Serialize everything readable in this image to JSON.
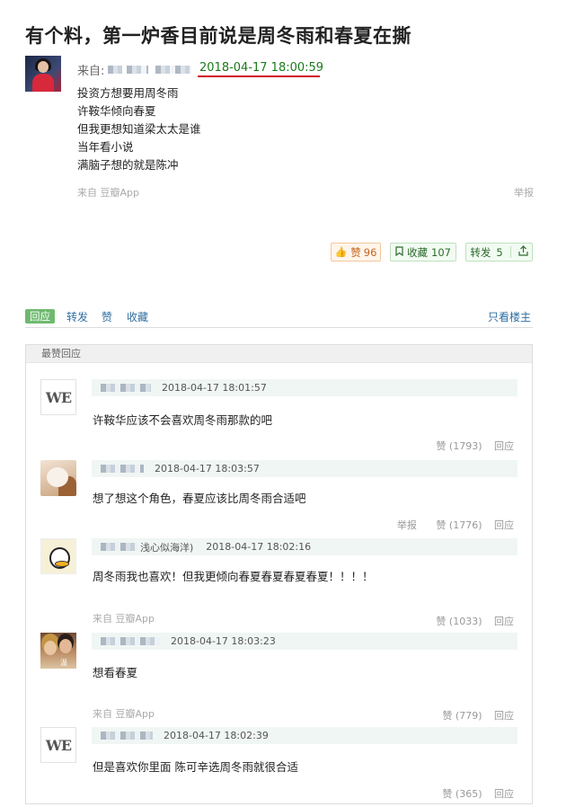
{
  "post": {
    "title": "有个料，第一炉香目前说是周冬雨和春夏在撕",
    "from_label": "来自: ",
    "published": "2018-04-17 18:00:59",
    "body": [
      "投资方想要用周冬雨",
      "许鞍华倾向春夏",
      "但我更想知道梁太太是谁",
      "当年看小说",
      "满脑子想的就是陈冲"
    ],
    "source": "来自 豆瓣App",
    "report": "举报",
    "like_label": "赞",
    "like_count": "96",
    "collect_label": "收藏",
    "collect_count": "107",
    "share_label": "转发",
    "share_count": "5",
    "accent_green": "#6fb96f",
    "accent_red": "#d0021b"
  },
  "tabs": {
    "reply": "回应",
    "forward": "转发",
    "praise": "赞",
    "collect": "收藏",
    "host_only": "只看楼主"
  },
  "replies_section": {
    "header": "最赞回应",
    "items": [
      {
        "avatar": "we-logo",
        "avatar_text": "WE",
        "name_visible": "",
        "time": "2018-04-17 18:01:57",
        "content": "许鞍华应该不会喜欢周冬雨那款的吧",
        "source": "",
        "report": "",
        "likes": "赞 (1793)",
        "reply": "回应"
      },
      {
        "avatar": "cat-dog-photo",
        "avatar_text": "",
        "name_visible": "",
        "time": "2018-04-17 18:03:57",
        "content": "想了想这个角色，春夏应该比周冬雨合适吧",
        "source": "",
        "report": "举报",
        "likes": "赞 (1776)",
        "reply": "回应"
      },
      {
        "avatar": "duck-cartoon",
        "avatar_text": "",
        "name_visible": "浅心似海洋)",
        "time": "2018-04-17 18:02:16",
        "content": "周冬雨我也喜欢！但我更倾向春夏春夏春夏春夏！！！！",
        "source": "来自 豆瓣App",
        "report": "",
        "likes": "赞 (1033)",
        "reply": "回应"
      },
      {
        "avatar": "couple-photo",
        "avatar_text": "",
        "name_visible": "",
        "time": "2018-04-17 18:03:23",
        "content": "想看春夏",
        "source": "来自 豆瓣App",
        "report": "",
        "likes": "赞 (779)",
        "reply": "回应"
      },
      {
        "avatar": "we-logo",
        "avatar_text": "WE",
        "name_visible": "",
        "time": "2018-04-17 18:02:39",
        "content": "但是喜欢你里面 陈可辛选周冬雨就很合适",
        "source": "",
        "report": "",
        "likes": "赞 (365)",
        "reply": "回应"
      }
    ]
  }
}
